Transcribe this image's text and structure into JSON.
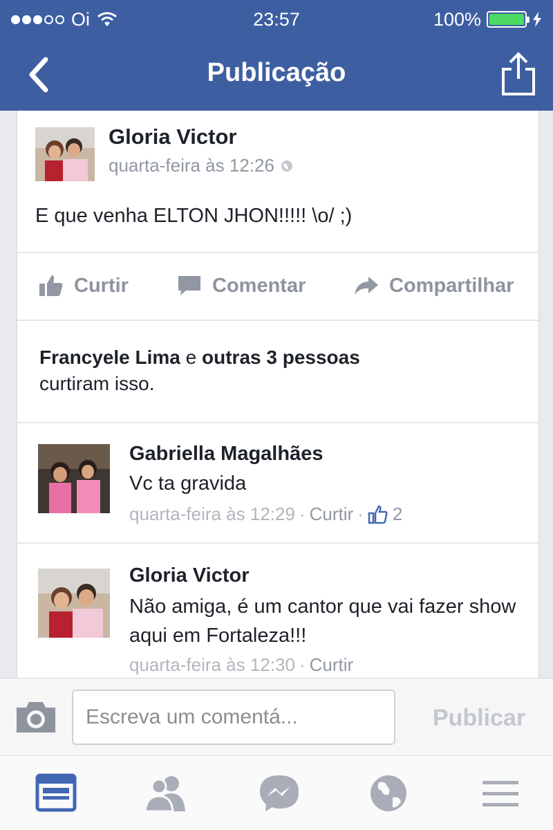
{
  "status_bar": {
    "carrier": "Oi",
    "time": "23:57",
    "battery": "100%"
  },
  "nav": {
    "title": "Publicação"
  },
  "post": {
    "author": "Gloria Victor",
    "time": "quarta-feira às 12:26",
    "text": "E que venha ELTON JHON!!!!! \\o/ ;)",
    "actions": {
      "like": "Curtir",
      "comment": "Comentar",
      "share": "Compartilhar"
    },
    "likes": {
      "names": "Francyele Lima",
      "connector": " e ",
      "others": "outras 3 pessoas",
      "suffix": "curtiram isso."
    }
  },
  "comments": [
    {
      "author": "Gabriella Magalhães",
      "text": "Vc ta gravida",
      "time": "quarta-feira às 12:29",
      "separator": "·",
      "like_label": "Curtir",
      "like_count": "2"
    },
    {
      "author": "Gloria Victor",
      "text": "Não amiga, é um cantor que vai fazer show aqui em Fortaleza!!!",
      "time": "quarta-feira às 12:30",
      "separator": "·",
      "like_label": "Curtir"
    }
  ],
  "composer": {
    "placeholder": "Escreva um comentá...",
    "publish_label": "Publicar"
  },
  "tabs": [
    "news-feed",
    "friend-requests",
    "messenger",
    "notifications",
    "more"
  ],
  "colors": {
    "brand": "#3d5fa2",
    "active_tab": "#4267b2",
    "inactive": "#a8adb7"
  }
}
